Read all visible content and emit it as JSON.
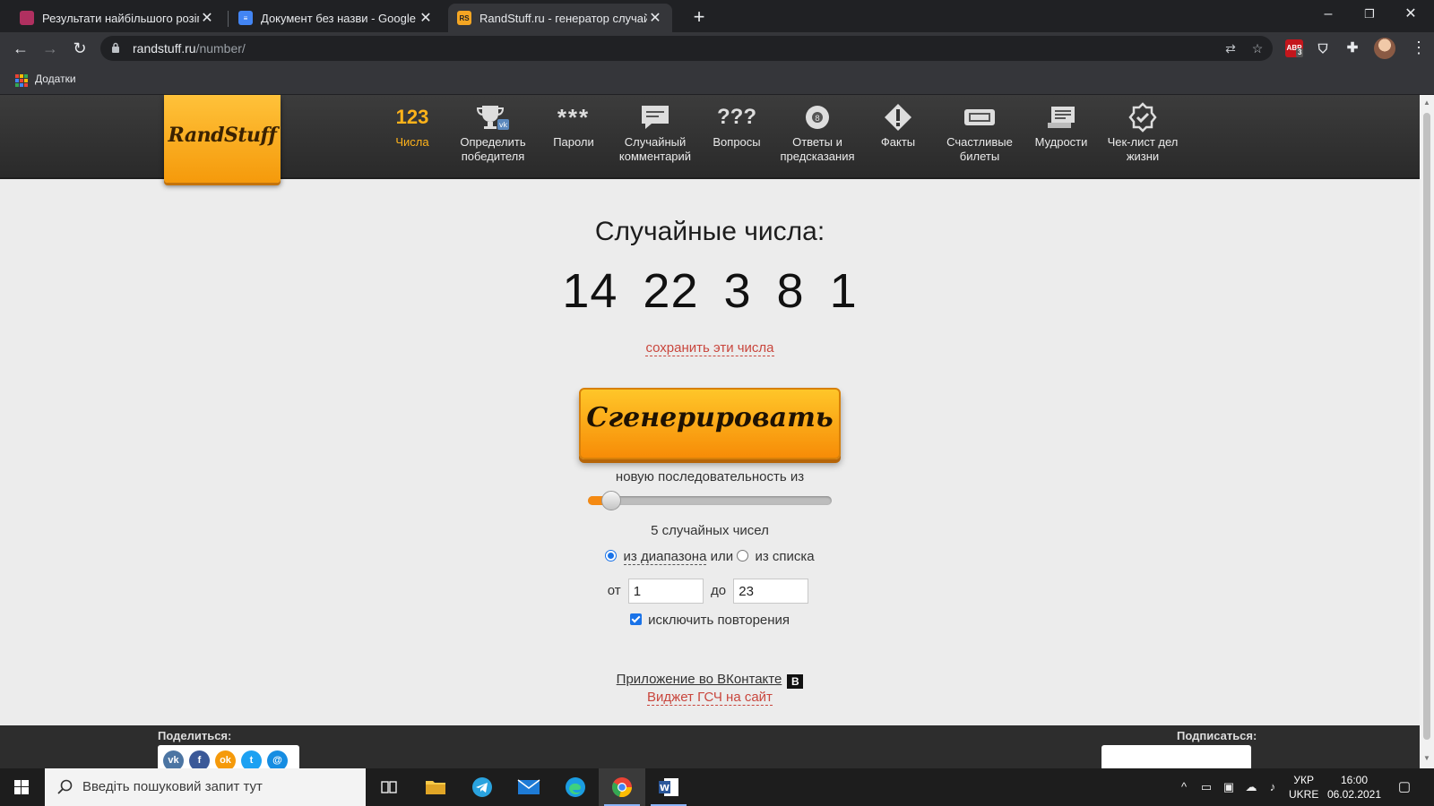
{
  "browser": {
    "tabs": [
      {
        "title": "Результати найбільшого розіграшу",
        "active": false
      },
      {
        "title": "Документ без назви - Google Документи",
        "active": false
      },
      {
        "title": "RandStuff.ru - генератор случайных чисел",
        "active": true
      }
    ],
    "url_host": "randstuff.ru",
    "url_path": "/number/",
    "bookmarks_label": "Додатки",
    "extension_badge": "3"
  },
  "site": {
    "logo": "RandStuff",
    "nav": [
      {
        "icon_text": "123",
        "label": "Числа",
        "active": true
      },
      {
        "label": "Определить победителя"
      },
      {
        "icon_text": "***",
        "label": "Пароли"
      },
      {
        "label": "Случайный комментарий"
      },
      {
        "icon_text": "???",
        "label": "Вопросы"
      },
      {
        "label": "Ответы и предсказания"
      },
      {
        "label": "Факты"
      },
      {
        "label": "Счастливые билеты"
      },
      {
        "label": "Мудрости"
      },
      {
        "label": "Чек-лист дел жизни"
      }
    ]
  },
  "main": {
    "title": "Случайные числа:",
    "numbers": [
      "14",
      "22",
      "3",
      "8",
      "1"
    ],
    "save_link": "сохранить эти числа",
    "generate_button": "Сгенерировать",
    "sequence_label": "новую последовательность из",
    "count_slider_value": 5,
    "count_label": "5 случайных чисел",
    "mode": {
      "range_label": "из диапазона",
      "or": "или",
      "list_label": "из списка",
      "selected": "range"
    },
    "range": {
      "from_label": "от",
      "from_value": "1",
      "to_label": "до",
      "to_value": "23"
    },
    "exclude_repeats_label": "исключить повторения",
    "exclude_repeats_checked": true,
    "vk_app_link": "Приложение во ВКонтакте",
    "vk_badge": "В",
    "widget_link": "Виджет ГСЧ на сайт"
  },
  "footer": {
    "share_label": "Поделиться:",
    "share_buttons": [
      "vk",
      "facebook",
      "odnoklassniki",
      "twitter",
      "mail"
    ],
    "subscribe_label": "Подписаться:"
  },
  "taskbar": {
    "search_placeholder": "Введіть пошуковий запит тут",
    "lang_top": "УКР",
    "lang_bottom": "UKRE",
    "time": "16:00",
    "date": "06.02.2021"
  },
  "colors": {
    "accent_orange": "#f59a0b",
    "link_red": "#c9463d",
    "header_dark": "#333333",
    "nav_active": "#ffb31a"
  }
}
